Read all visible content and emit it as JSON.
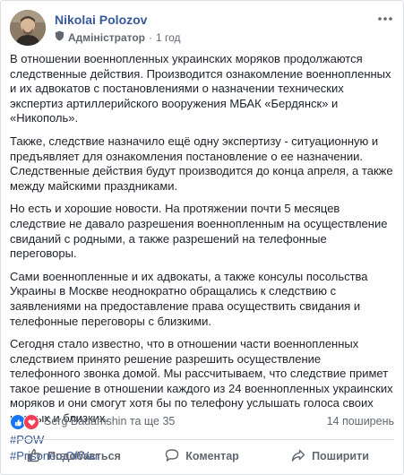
{
  "post": {
    "author": "Nikolai Polozov",
    "role": "Адміністратор",
    "separator": "·",
    "time": "1 год",
    "paragraphs": [
      "В отношении военнопленных украинских моряков продолжаются следственные действия. Производится ознакомление военнопленных и их адвокатов с постановлениями о назначении технических экспертиз артиллерийского вооружения МБАК «Бердянск» и «Никополь».",
      "Также, следствие назначило ещё одну экспертизу - ситуационную и предъявляет для ознакомления постановление о ее назначении. Следственные действия будут производится до конца апреля, а также между майскими праздниками.",
      "Но есть и хорошие новости. На протяжении почти 5 месяцев следствие не давало разрешения военнопленным на осуществление свиданий с родными, а также разрешений на телефонные переговоры.",
      "Сами военнопленные и их адвокаты, а также консулы посольства Украины в Москве неоднократно обращались к следствию с заявлениями на предоставление права осуществить свидания и телефонные переговоры с близкими.",
      "Сегодня стало известно, что в отношении части военнопленных следствием принято решение разрешить осуществление телефонного звонка домой. Мы рассчитываем, что следствие примет такое решение в отношении каждого из 24 военнопленных украинских моряков и они смогут хотя бы по телефону услышать голоса своих родных и близких."
    ],
    "hashtags": [
      "#POW",
      "#PrisonersOfWar"
    ]
  },
  "reactions": {
    "text": "Serg Badamshin та ще 35",
    "shares": "14 поширень",
    "icons": [
      "like-icon",
      "love-icon"
    ]
  },
  "actions": {
    "like_label": "Подобається",
    "comment_label": "Коментар",
    "share_label": "Поширити"
  },
  "colors": {
    "link": "#385898",
    "text": "#1d2129",
    "muted": "#606770",
    "like": "#1877f2",
    "love": "#f33e58"
  }
}
